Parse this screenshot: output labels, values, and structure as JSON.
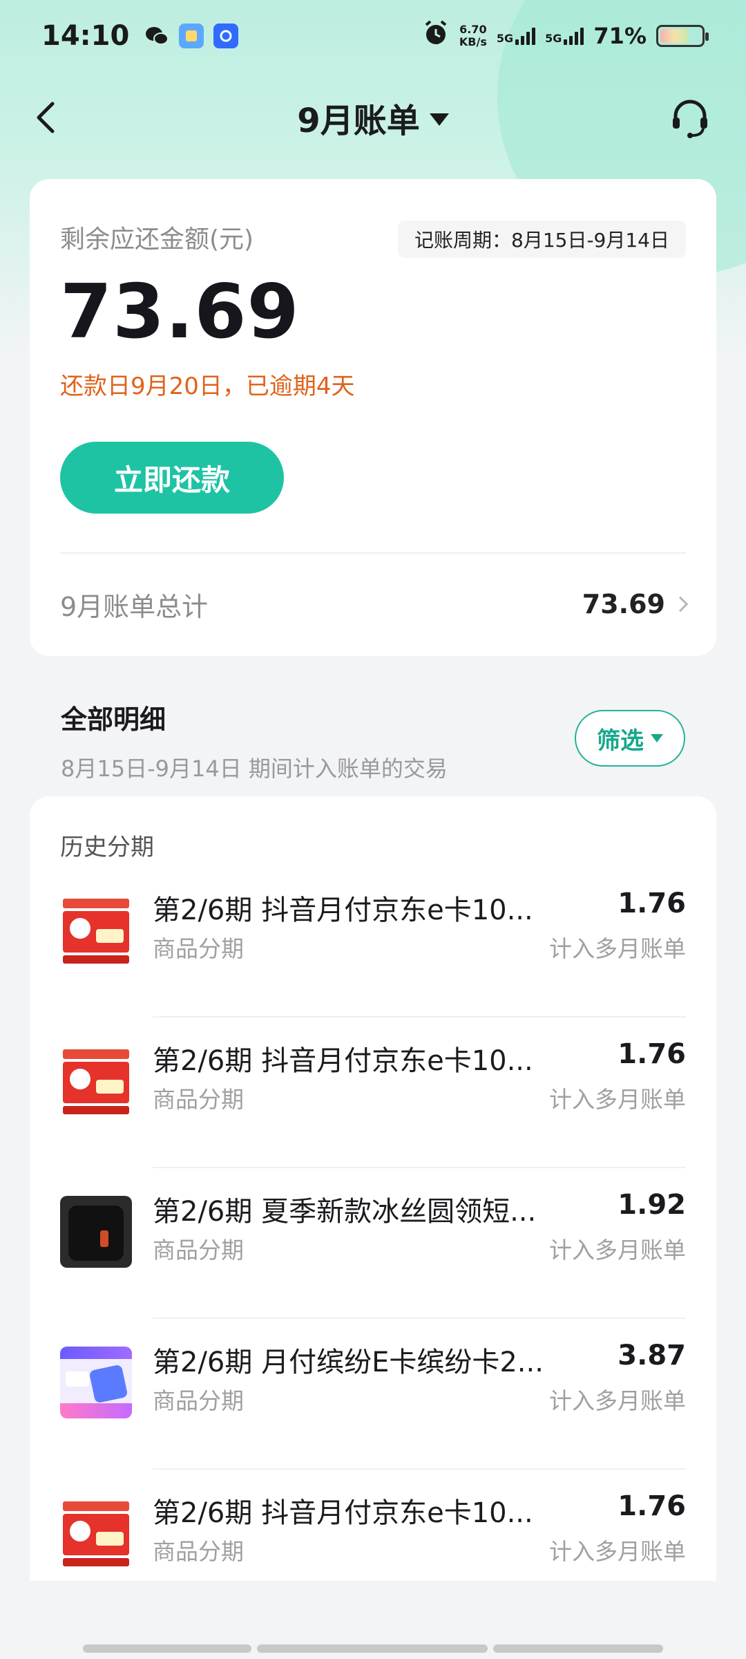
{
  "status_bar": {
    "time": "14:10",
    "net_speed_value": "6.70",
    "net_speed_unit": "KB/s",
    "sim1": "5G",
    "sim2": "5G",
    "battery": "71%",
    "battery_level": 0.71
  },
  "nav": {
    "title": "9月账单",
    "back_icon": "back-arrow-icon",
    "service_icon": "headset-icon"
  },
  "summary": {
    "remaining_label": "剩余应还金额(元)",
    "period": "记账周期：8月15日-9月14日",
    "amount": "73.69",
    "due_note": "还款日9月20日，已逾期4天",
    "pay_button": "立即还款",
    "total_label": "9月账单总计",
    "total_amount": "73.69"
  },
  "details": {
    "title": "全部明细",
    "subtitle": "8月15日-9月14日 期间计入账单的交易",
    "filter": "筛选"
  },
  "list": {
    "section": "历史分期",
    "rows": [
      {
        "title": "第2/6期 抖音月付京东e卡10...",
        "type": "商品分期",
        "amount": "1.76",
        "note": "计入多月账单",
        "thumb": "jd-ecard-red"
      },
      {
        "title": "第2/6期 抖音月付京东e卡10...",
        "type": "商品分期",
        "amount": "1.76",
        "note": "计入多月账单",
        "thumb": "jd-ecard-red"
      },
      {
        "title": "第2/6期 夏季新款冰丝圆领短...",
        "type": "商品分期",
        "amount": "1.92",
        "note": "计入多月账单",
        "thumb": "black-tshirt"
      },
      {
        "title": "第2/6期 月付缤纷E卡缤纷卡2...",
        "type": "商品分期",
        "amount": "3.87",
        "note": "计入多月账单",
        "thumb": "binfen-ecard"
      },
      {
        "title": "第2/6期 抖音月付京东e卡10...",
        "type": "商品分期",
        "amount": "1.76",
        "note": "计入多月账单",
        "thumb": "jd-ecard-red"
      }
    ]
  },
  "colors": {
    "accent": "#1ec3a4",
    "warning": "#e0621a",
    "header_bg": "#bdeee0"
  }
}
